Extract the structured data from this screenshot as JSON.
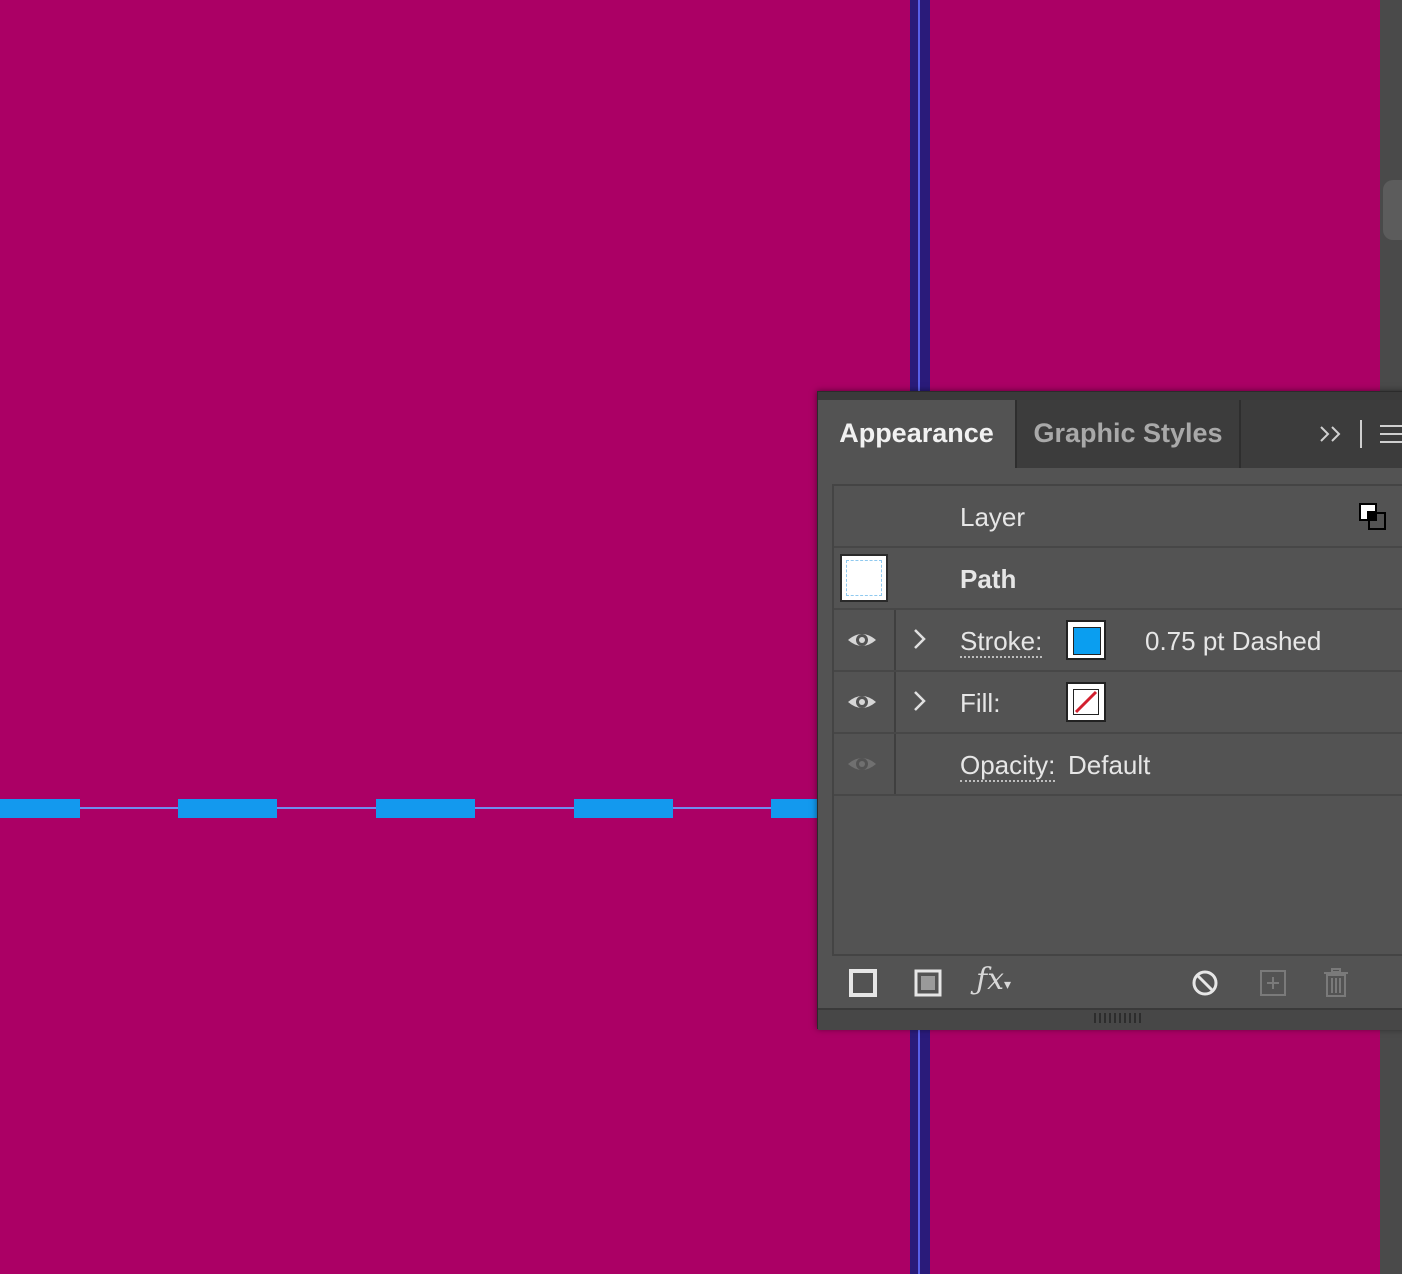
{
  "colors": {
    "canvas": "#ab0065",
    "dash_stroke": "#1399ee",
    "guide": "#2a1b7a",
    "panel_bg": "#535353"
  },
  "panel": {
    "tabs": [
      {
        "label": "Appearance",
        "active": true
      },
      {
        "label": "Graphic Styles",
        "active": false
      }
    ],
    "overflow_icon": "double-chevron-right-icon",
    "menu_icon": "hamburger-menu-icon",
    "rows": {
      "layer": {
        "label": "Layer",
        "icon": "layer-target-icon"
      },
      "path": {
        "label": "Path",
        "thumbnail": "path-thumbnail"
      },
      "stroke": {
        "label": "Stroke:",
        "value": "0.75 pt Dashed",
        "swatch_color": "#0a9ef0"
      },
      "fill": {
        "label": "Fill:",
        "swatch": "none-red-slash"
      },
      "opacity": {
        "label": "Opacity:",
        "value": "Default"
      }
    },
    "footer_icons": [
      "add-new-stroke-icon",
      "add-new-fill-icon",
      "fx-icon",
      "clear-appearance-icon",
      "duplicate-item-icon",
      "delete-item-icon"
    ]
  }
}
